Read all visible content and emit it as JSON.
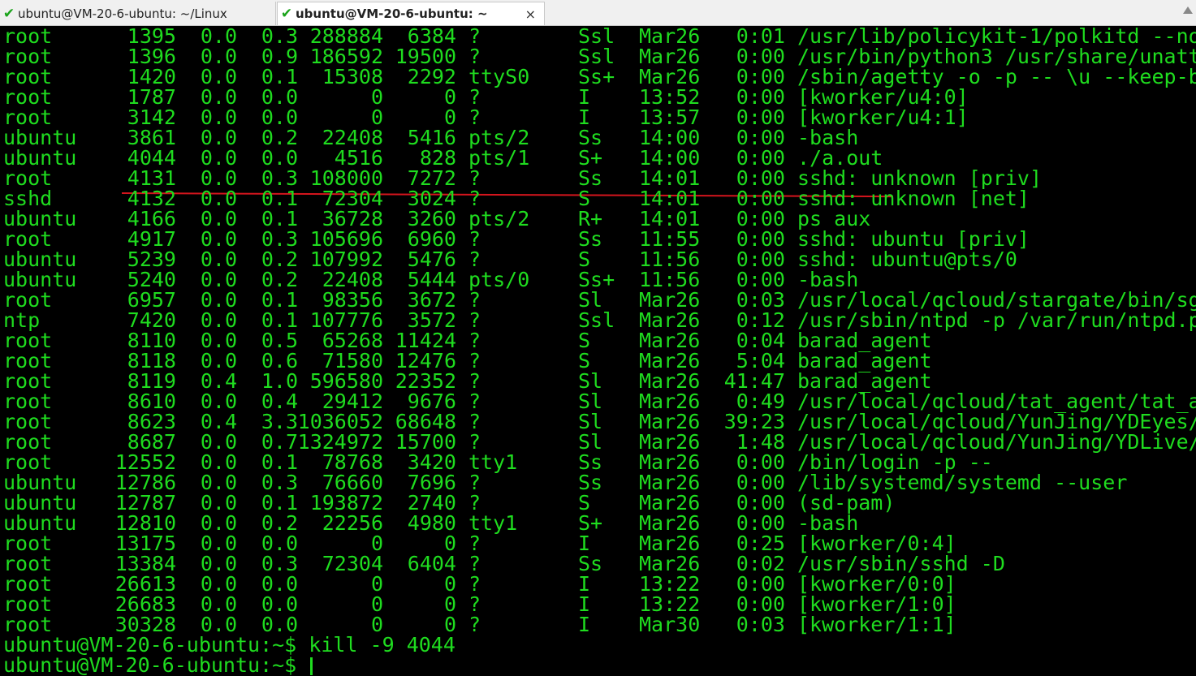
{
  "tabs": [
    {
      "label": "ubuntu@VM-20-6-ubuntu: ~/Linux",
      "active": false,
      "status_icon": "check-icon"
    },
    {
      "label": "ubuntu@VM-20-6-ubuntu: ~",
      "active": true,
      "status_icon": "check-icon",
      "close": "×"
    }
  ],
  "colors": {
    "terminal_fg": "#1fdc1f",
    "terminal_bg": "#000000",
    "annotation": "#d4151d"
  },
  "processes": [
    {
      "user": "root",
      "pid": "1395",
      "cpu": "0.0",
      "mem": "0.3",
      "vsz": "288884",
      "rss": "6384",
      "tty": "?",
      "stat": "Ssl",
      "start": "Mar26",
      "time": "0:01",
      "command": "/usr/lib/policykit-1/polkitd --no"
    },
    {
      "user": "root",
      "pid": "1396",
      "cpu": "0.0",
      "mem": "0.9",
      "vsz": "186592",
      "rss": "19500",
      "tty": "?",
      "stat": "Ssl",
      "start": "Mar26",
      "time": "0:00",
      "command": "/usr/bin/python3 /usr/share/unatt"
    },
    {
      "user": "root",
      "pid": "1420",
      "cpu": "0.0",
      "mem": "0.1",
      "vsz": "15308",
      "rss": "2292",
      "tty": "ttyS0",
      "stat": "Ss+",
      "start": "Mar26",
      "time": "0:00",
      "command": "/sbin/agetty -o -p -- \\u --keep-b"
    },
    {
      "user": "root",
      "pid": "1787",
      "cpu": "0.0",
      "mem": "0.0",
      "vsz": "0",
      "rss": "0",
      "tty": "?",
      "stat": "I",
      "start": "13:52",
      "time": "0:00",
      "command": "[kworker/u4:0]"
    },
    {
      "user": "root",
      "pid": "3142",
      "cpu": "0.0",
      "mem": "0.0",
      "vsz": "0",
      "rss": "0",
      "tty": "?",
      "stat": "I",
      "start": "13:57",
      "time": "0:00",
      "command": "[kworker/u4:1]"
    },
    {
      "user": "ubuntu",
      "pid": "3861",
      "cpu": "0.0",
      "mem": "0.2",
      "vsz": "22408",
      "rss": "5416",
      "tty": "pts/2",
      "stat": "Ss",
      "start": "14:00",
      "time": "0:00",
      "command": "-bash"
    },
    {
      "user": "ubuntu",
      "pid": "4044",
      "cpu": "0.0",
      "mem": "0.0",
      "vsz": "4516",
      "rss": "828",
      "tty": "pts/1",
      "stat": "S+",
      "start": "14:00",
      "time": "0:00",
      "command": "./a.out"
    },
    {
      "user": "root",
      "pid": "4131",
      "cpu": "0.0",
      "mem": "0.3",
      "vsz": "108000",
      "rss": "7272",
      "tty": "?",
      "stat": "Ss",
      "start": "14:01",
      "time": "0:00",
      "command": "sshd: unknown [priv]"
    },
    {
      "user": "sshd",
      "pid": "4132",
      "cpu": "0.0",
      "mem": "0.1",
      "vsz": "72304",
      "rss": "3024",
      "tty": "?",
      "stat": "S",
      "start": "14:01",
      "time": "0:00",
      "command": "sshd: unknown [net]"
    },
    {
      "user": "ubuntu",
      "pid": "4166",
      "cpu": "0.0",
      "mem": "0.1",
      "vsz": "36728",
      "rss": "3260",
      "tty": "pts/2",
      "stat": "R+",
      "start": "14:01",
      "time": "0:00",
      "command": "ps aux"
    },
    {
      "user": "root",
      "pid": "4917",
      "cpu": "0.0",
      "mem": "0.3",
      "vsz": "105696",
      "rss": "6960",
      "tty": "?",
      "stat": "Ss",
      "start": "11:55",
      "time": "0:00",
      "command": "sshd: ubuntu [priv]"
    },
    {
      "user": "ubuntu",
      "pid": "5239",
      "cpu": "0.0",
      "mem": "0.2",
      "vsz": "107992",
      "rss": "5476",
      "tty": "?",
      "stat": "S",
      "start": "11:56",
      "time": "0:00",
      "command": "sshd: ubuntu@pts/0"
    },
    {
      "user": "ubuntu",
      "pid": "5240",
      "cpu": "0.0",
      "mem": "0.2",
      "vsz": "22408",
      "rss": "5444",
      "tty": "pts/0",
      "stat": "Ss+",
      "start": "11:56",
      "time": "0:00",
      "command": "-bash"
    },
    {
      "user": "root",
      "pid": "6957",
      "cpu": "0.0",
      "mem": "0.1",
      "vsz": "98356",
      "rss": "3672",
      "tty": "?",
      "stat": "Sl",
      "start": "Mar26",
      "time": "0:03",
      "command": "/usr/local/qcloud/stargate/bin/sg"
    },
    {
      "user": "ntp",
      "pid": "7420",
      "cpu": "0.0",
      "mem": "0.1",
      "vsz": "107776",
      "rss": "3572",
      "tty": "?",
      "stat": "Ssl",
      "start": "Mar26",
      "time": "0:12",
      "command": "/usr/sbin/ntpd -p /var/run/ntpd.p"
    },
    {
      "user": "root",
      "pid": "8110",
      "cpu": "0.0",
      "mem": "0.5",
      "vsz": "65268",
      "rss": "11424",
      "tty": "?",
      "stat": "S",
      "start": "Mar26",
      "time": "0:04",
      "command": "barad_agent"
    },
    {
      "user": "root",
      "pid": "8118",
      "cpu": "0.0",
      "mem": "0.6",
      "vsz": "71580",
      "rss": "12476",
      "tty": "?",
      "stat": "S",
      "start": "Mar26",
      "time": "5:04",
      "command": "barad_agent"
    },
    {
      "user": "root",
      "pid": "8119",
      "cpu": "0.4",
      "mem": "1.0",
      "vsz": "596580",
      "rss": "22352",
      "tty": "?",
      "stat": "Sl",
      "start": "Mar26",
      "time": "41:47",
      "command": "barad_agent"
    },
    {
      "user": "root",
      "pid": "8610",
      "cpu": "0.0",
      "mem": "0.4",
      "vsz": "29412",
      "rss": "9676",
      "tty": "?",
      "stat": "Sl",
      "start": "Mar26",
      "time": "0:49",
      "command": "/usr/local/qcloud/tat_agent/tat_a"
    },
    {
      "user": "root",
      "pid": "8623",
      "cpu": "0.4",
      "mem": "3.3",
      "vsz": "1036052",
      "rss": "68648",
      "tty": "?",
      "stat": "Sl",
      "start": "Mar26",
      "time": "39:23",
      "command": "/usr/local/qcloud/YunJing/YDEyes/"
    },
    {
      "user": "root",
      "pid": "8687",
      "cpu": "0.0",
      "mem": "0.7",
      "vsz": "1324972",
      "rss": "15700",
      "tty": "?",
      "stat": "Sl",
      "start": "Mar26",
      "time": "1:48",
      "command": "/usr/local/qcloud/YunJing/YDLive/"
    },
    {
      "user": "root",
      "pid": "12552",
      "cpu": "0.0",
      "mem": "0.1",
      "vsz": "78768",
      "rss": "3420",
      "tty": "tty1",
      "stat": "Ss",
      "start": "Mar26",
      "time": "0:00",
      "command": "/bin/login -p --"
    },
    {
      "user": "ubuntu",
      "pid": "12786",
      "cpu": "0.0",
      "mem": "0.3",
      "vsz": "76660",
      "rss": "7696",
      "tty": "?",
      "stat": "Ss",
      "start": "Mar26",
      "time": "0:00",
      "command": "/lib/systemd/systemd --user"
    },
    {
      "user": "ubuntu",
      "pid": "12787",
      "cpu": "0.0",
      "mem": "0.1",
      "vsz": "193872",
      "rss": "2740",
      "tty": "?",
      "stat": "S",
      "start": "Mar26",
      "time": "0:00",
      "command": "(sd-pam)"
    },
    {
      "user": "ubuntu",
      "pid": "12810",
      "cpu": "0.0",
      "mem": "0.2",
      "vsz": "22256",
      "rss": "4980",
      "tty": "tty1",
      "stat": "S+",
      "start": "Mar26",
      "time": "0:00",
      "command": "-bash"
    },
    {
      "user": "root",
      "pid": "13175",
      "cpu": "0.0",
      "mem": "0.0",
      "vsz": "0",
      "rss": "0",
      "tty": "?",
      "stat": "I",
      "start": "Mar26",
      "time": "0:25",
      "command": "[kworker/0:4]"
    },
    {
      "user": "root",
      "pid": "13384",
      "cpu": "0.0",
      "mem": "0.3",
      "vsz": "72304",
      "rss": "6404",
      "tty": "?",
      "stat": "Ss",
      "start": "Mar26",
      "time": "0:02",
      "command": "/usr/sbin/sshd -D"
    },
    {
      "user": "root",
      "pid": "26613",
      "cpu": "0.0",
      "mem": "0.0",
      "vsz": "0",
      "rss": "0",
      "tty": "?",
      "stat": "I",
      "start": "13:22",
      "time": "0:00",
      "command": "[kworker/0:0]"
    },
    {
      "user": "root",
      "pid": "26683",
      "cpu": "0.0",
      "mem": "0.0",
      "vsz": "0",
      "rss": "0",
      "tty": "?",
      "stat": "I",
      "start": "13:22",
      "time": "0:00",
      "command": "[kworker/1:0]"
    },
    {
      "user": "root",
      "pid": "30328",
      "cpu": "0.0",
      "mem": "0.0",
      "vsz": "0",
      "rss": "0",
      "tty": "?",
      "stat": "I",
      "start": "Mar30",
      "time": "0:03",
      "command": "[kworker/1:1]"
    }
  ],
  "prompt_lines": [
    "ubuntu@VM-20-6-ubuntu:~$ kill -9 4044",
    "ubuntu@VM-20-6-ubuntu:~$ "
  ]
}
